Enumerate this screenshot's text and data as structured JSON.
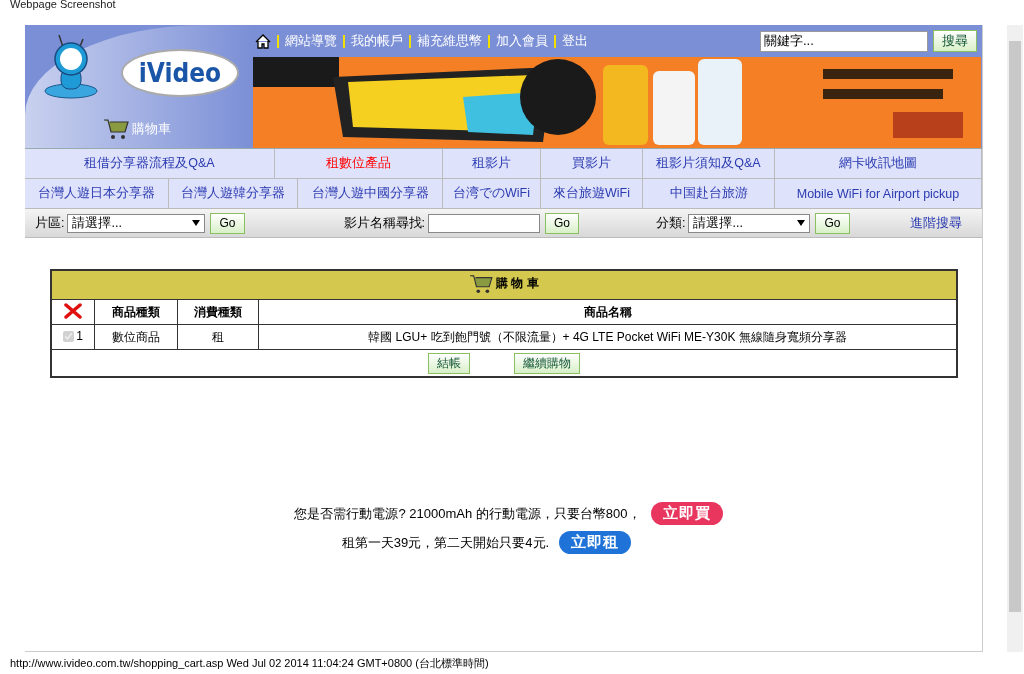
{
  "caption": "Webpage Screenshot",
  "header": {
    "logo": "iVideo",
    "cart_link": "購物車",
    "top_links": [
      "網站導覽",
      "我的帳戶",
      "補充維思幣",
      "加入會員",
      "登出"
    ],
    "search": {
      "value": "關鍵字..."
    },
    "search_button": "搜尋"
  },
  "nav_rows": [
    [
      {
        "label": "租借分享器流程及Q&A",
        "selected": false
      },
      {
        "label": "租數位產品",
        "selected": true
      },
      {
        "label": "租影片",
        "selected": false
      },
      {
        "label": "買影片",
        "selected": false
      },
      {
        "label": "租影片須知及Q&A",
        "selected": false
      },
      {
        "label": "網卡收訊地圖",
        "selected": false
      }
    ],
    [
      {
        "label": "台灣人遊日本分享器",
        "selected": false
      },
      {
        "label": "台灣人遊韓分享器",
        "selected": false
      },
      {
        "label": "台灣人遊中國分享器",
        "selected": false
      },
      {
        "label": "台湾でのWiFi",
        "selected": false
      },
      {
        "label": "來台旅遊WiFi",
        "selected": false
      },
      {
        "label": "中国赴台旅游",
        "selected": false
      },
      {
        "label": "Mobile WiFi for Airport pickup",
        "selected": false
      }
    ]
  ],
  "filter_bar": {
    "region_label": "片區:",
    "region_select": "請選擇...",
    "title_label": "影片名稱尋找:",
    "category_label": "分類:",
    "category_select": "請選擇...",
    "go_buttons": [
      "Go",
      "Go",
      "Go"
    ],
    "advanced_link": "進階搜尋"
  },
  "cart": {
    "title": "購 物 車",
    "columns": [
      "商品種類",
      "消費種類",
      "商品名稱"
    ],
    "rows": [
      {
        "checked": true,
        "index": "1",
        "product_type": "數位商品",
        "consumption_type": "租",
        "name": "韓國 LGU+ 吃到飽門號（不限流量）+ 4G LTE Pocket WiFi ME-Y30K 無線隨身寬頻分享器"
      }
    ],
    "buttons": [
      "結帳",
      "繼續購物"
    ]
  },
  "promo": [
    {
      "text": "您是否需行動電源? 21000mAh 的行動電源，只要台幣800，",
      "button": "立即買",
      "color": "#e8365e"
    },
    {
      "text": "租第一天39元，第二天開始只要4元.",
      "button": "立即租",
      "color": "#1f73d8"
    }
  ],
  "status_bar": "http://www.ivideo.com.tw/shopping_cart.asp Wed Jul 02 2014 11:04:24 GMT+0800 (台北標準時間)"
}
